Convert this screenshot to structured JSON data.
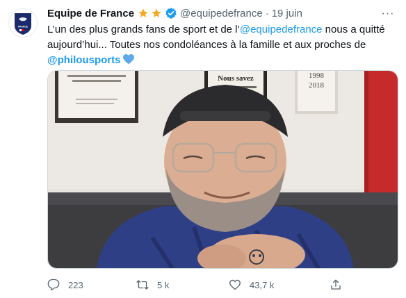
{
  "author": {
    "display_name": "Equipe de France",
    "handle": "@equipedefrance",
    "separator": "·",
    "timestamp": "19 juin",
    "badge_stars": 2,
    "verified": true,
    "avatar_text": "FRANCE"
  },
  "tweet": {
    "text_part1": "L’un des plus grands fans de sport et de l’",
    "mention1": "@equipedefrance",
    "text_part2": " nous a quitté aujourd’hui... Toutes nos condoléances à la famille et aux proches de ",
    "mention2": "@philousports",
    "heart_color": "#5da9e9",
    "more_label": "···"
  },
  "media": {
    "wall_poster_text": "Nous savez",
    "frame_years": "1998",
    "frame_year2": "2018"
  },
  "actions": {
    "replies": "223",
    "retweets": "5 k",
    "likes": "43,7 k"
  },
  "colors": {
    "link": "#1d9bf0",
    "muted": "#536471",
    "star": "#f4a825",
    "verified": "#1d9bf0"
  }
}
